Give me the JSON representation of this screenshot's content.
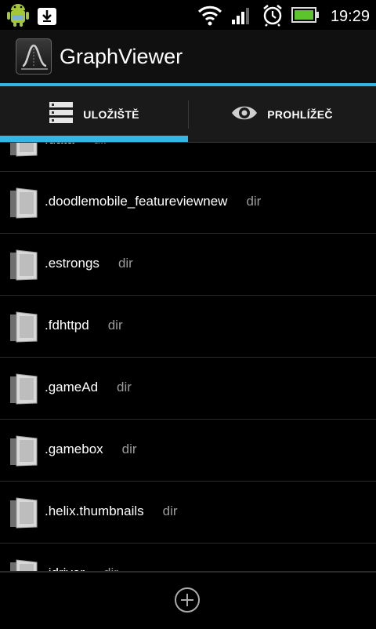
{
  "status_bar": {
    "time": "19:29",
    "icons": [
      "android-notification-icon",
      "download-icon",
      "wifi-icon",
      "signal-icon",
      "alarm-icon",
      "battery-icon"
    ]
  },
  "action_bar": {
    "title": "GraphViewer",
    "icon": "graph-app-icon"
  },
  "tabs": [
    {
      "label": "ULOŽIŠTĚ",
      "icon": "storage-icon",
      "selected": true
    },
    {
      "label": "PROHLÍŽEČ",
      "icon": "eye-icon",
      "selected": false
    }
  ],
  "list": {
    "items": [
      {
        "name": ".data",
        "type": "dir"
      },
      {
        "name": ".doodlemobile_featureviewnew",
        "type": "dir"
      },
      {
        "name": ".estrongs",
        "type": "dir"
      },
      {
        "name": ".fdhttpd",
        "type": "dir"
      },
      {
        "name": ".gameAd",
        "type": "dir"
      },
      {
        "name": ".gamebox",
        "type": "dir"
      },
      {
        "name": ".helix.thumbnails",
        "type": "dir"
      },
      {
        "name": ".idriver",
        "type": "dir"
      }
    ]
  },
  "bottom_bar": {
    "add_icon": "add-circle-icon"
  },
  "colors": {
    "accent": "#33b5e5",
    "background": "#000000",
    "secondary_text": "#9a9a9a"
  }
}
